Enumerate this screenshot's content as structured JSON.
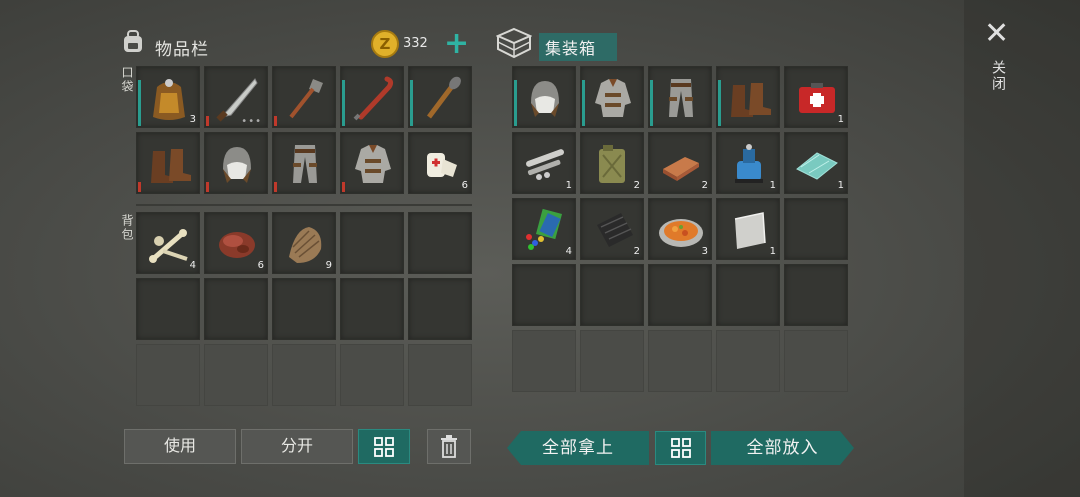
{
  "inventory": {
    "title": "物品栏",
    "coin_count": "332",
    "plus_symbol": "+",
    "pocket_label": "口袋",
    "backpack_label": "背包",
    "pocket_slots": [
      {
        "icon": "loot-bag-icon",
        "count": "3",
        "dur": "teal"
      },
      {
        "icon": "machete-icon",
        "count": "",
        "dots": "•••",
        "dur": "red"
      },
      {
        "icon": "shovel-icon",
        "count": "",
        "dur": "red"
      },
      {
        "icon": "crowbar-icon",
        "count": "",
        "dur": "teal"
      },
      {
        "icon": "torch-club-icon",
        "count": "",
        "dur": "teal"
      },
      {
        "icon": "leather-boots-icon",
        "count": "",
        "dur": "red"
      },
      {
        "icon": "aviator-hat-icon",
        "count": "",
        "dur": "red"
      },
      {
        "icon": "armored-pants-icon",
        "count": "",
        "dur": "red"
      },
      {
        "icon": "armored-jacket-icon",
        "count": "",
        "dur": "red"
      },
      {
        "icon": "bandage-icon",
        "count": "6",
        "dur": ""
      }
    ],
    "backpack_slots": [
      {
        "icon": "bones-icon",
        "count": "4"
      },
      {
        "icon": "raw-meat-icon",
        "count": "6"
      },
      {
        "icon": "fur-pelt-icon",
        "count": "9"
      }
    ],
    "buttons": {
      "use": "使用",
      "split": "分开",
      "sort_icon": "grid-sort-icon",
      "trash_icon": "trash-icon"
    }
  },
  "storage": {
    "title": "集装箱",
    "slots": [
      {
        "icon": "aviator-hat-icon",
        "count": "",
        "dur": "teal"
      },
      {
        "icon": "armored-jacket-icon",
        "count": "",
        "dur": "teal"
      },
      {
        "icon": "armored-pants-icon",
        "count": "",
        "dur": "teal"
      },
      {
        "icon": "leather-boots-icon",
        "count": "",
        "dur": "teal"
      },
      {
        "icon": "first-aid-kit-icon",
        "count": "1",
        "dur": ""
      },
      {
        "icon": "pipe-parts-icon",
        "count": "1",
        "dur": ""
      },
      {
        "icon": "jerry-can-icon",
        "count": "2",
        "dur": ""
      },
      {
        "icon": "copper-ingot-icon",
        "count": "2",
        "dur": ""
      },
      {
        "icon": "water-pump-icon",
        "count": "1",
        "dur": ""
      },
      {
        "icon": "glass-sheet-icon",
        "count": "1",
        "dur": ""
      },
      {
        "icon": "electronics-icon",
        "count": "4",
        "dur": ""
      },
      {
        "icon": "rubber-sheet-icon",
        "count": "2",
        "dur": ""
      },
      {
        "icon": "stew-bowl-icon",
        "count": "3",
        "dur": ""
      },
      {
        "icon": "metal-plate-icon",
        "count": "1",
        "dur": ""
      }
    ],
    "take_all": "全部拿上",
    "put_all": "全部放入"
  },
  "close": {
    "symbol": "✕",
    "label": "关闭"
  },
  "colors": {
    "accent_teal": "#1f6a62",
    "durability_red": "#c0392b",
    "coin_gold": "#e0b02a"
  }
}
